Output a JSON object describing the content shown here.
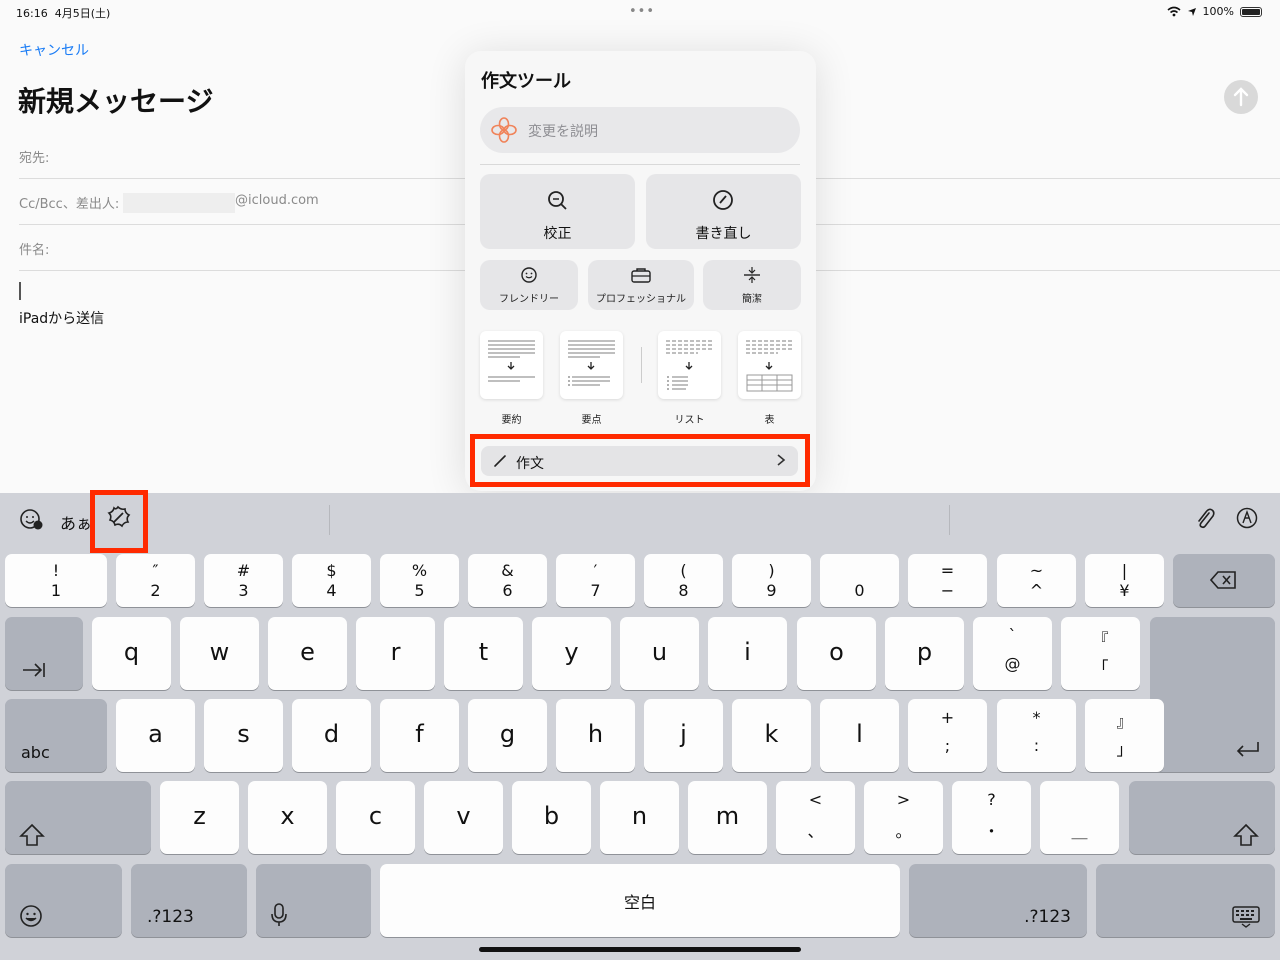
{
  "status_bar": {
    "time": "16:16",
    "date": "4月5日(土)",
    "battery": "100%"
  },
  "compose": {
    "cancel": "キャンセル",
    "title": "新規メッセージ",
    "to_label": "宛先:",
    "cc_label": "Cc/Bcc、差出人:",
    "from_domain": "@icloud.com",
    "subject_label": "件名:",
    "signature": "iPadから送信"
  },
  "writing_tools": {
    "title": "作文ツール",
    "describe_placeholder": "変更を説明",
    "proofread": "校正",
    "rewrite": "書き直し",
    "friendly": "フレンドリー",
    "professional": "プロフェッショナル",
    "concise": "簡潔",
    "summary": "要約",
    "key_points": "要点",
    "list": "リスト",
    "table": "表",
    "compose": "作文"
  },
  "keyboard": {
    "toolbar_ime": "あぁ",
    "row_numbers": [
      {
        "top": "!",
        "bot": "1"
      },
      {
        "top": "″",
        "bot": "2"
      },
      {
        "top": "#",
        "bot": "3"
      },
      {
        "top": "$",
        "bot": "4"
      },
      {
        "top": "%",
        "bot": "5"
      },
      {
        "top": "&",
        "bot": "6"
      },
      {
        "top": "′",
        "bot": "7"
      },
      {
        "top": "(",
        "bot": "8"
      },
      {
        "top": ")",
        "bot": "9"
      },
      {
        "top": "",
        "bot": "0"
      },
      {
        "top": "=",
        "bot": "−"
      },
      {
        "top": "~",
        "bot": "^"
      },
      {
        "top": "|",
        "bot": "¥"
      }
    ],
    "row_q": [
      "q",
      "w",
      "e",
      "r",
      "t",
      "y",
      "u",
      "i",
      "o",
      "p"
    ],
    "row_q_extra": [
      {
        "top": "`",
        "bot": "@"
      },
      {
        "top": "『",
        "bot": "「"
      }
    ],
    "row_a": [
      "a",
      "s",
      "d",
      "f",
      "g",
      "h",
      "j",
      "k",
      "l"
    ],
    "row_a_extra": [
      {
        "top": "+",
        "bot": ";"
      },
      {
        "top": "*",
        "bot": ":"
      },
      {
        "top": "』",
        "bot": "」"
      }
    ],
    "row_z": [
      "z",
      "x",
      "c",
      "v",
      "b",
      "n",
      "m"
    ],
    "row_z_extra": [
      {
        "top": "<",
        "bot": "、"
      },
      {
        "top": ">",
        "bot": "。"
      },
      {
        "top": "?",
        "bot": "・"
      },
      {
        "top": "",
        "bot": "＿"
      }
    ],
    "abc": "abc",
    "num_left": ".?123",
    "num_right": ".?123",
    "space": "空白"
  }
}
